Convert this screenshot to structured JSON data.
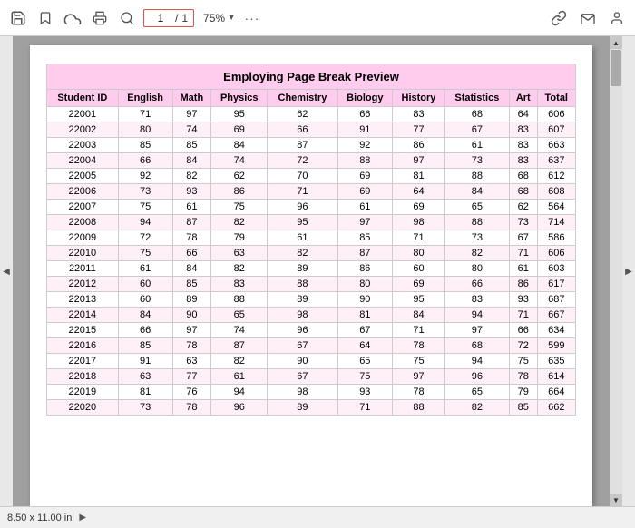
{
  "toolbar": {
    "page_current": "1",
    "page_sep": "/",
    "page_total": "1",
    "zoom_value": "75%",
    "more_label": "···"
  },
  "document": {
    "title": "Employing Page Break Preview",
    "columns": [
      "Student ID",
      "English",
      "Math",
      "Physics",
      "Chemistry",
      "Biology",
      "History",
      "Statistics",
      "Art",
      "Total"
    ],
    "rows": [
      [
        "22001",
        "71",
        "97",
        "95",
        "62",
        "66",
        "83",
        "68",
        "64",
        "606"
      ],
      [
        "22002",
        "80",
        "74",
        "69",
        "66",
        "91",
        "77",
        "67",
        "83",
        "607"
      ],
      [
        "22003",
        "85",
        "85",
        "84",
        "87",
        "92",
        "86",
        "61",
        "83",
        "663"
      ],
      [
        "22004",
        "66",
        "84",
        "74",
        "72",
        "88",
        "97",
        "73",
        "83",
        "637"
      ],
      [
        "22005",
        "92",
        "82",
        "62",
        "70",
        "69",
        "81",
        "88",
        "68",
        "612"
      ],
      [
        "22006",
        "73",
        "93",
        "86",
        "71",
        "69",
        "64",
        "84",
        "68",
        "608"
      ],
      [
        "22007",
        "75",
        "61",
        "75",
        "96",
        "61",
        "69",
        "65",
        "62",
        "564"
      ],
      [
        "22008",
        "94",
        "87",
        "82",
        "95",
        "97",
        "98",
        "88",
        "73",
        "714"
      ],
      [
        "22009",
        "72",
        "78",
        "79",
        "61",
        "85",
        "71",
        "73",
        "67",
        "586"
      ],
      [
        "22010",
        "75",
        "66",
        "63",
        "82",
        "87",
        "80",
        "82",
        "71",
        "606"
      ],
      [
        "22011",
        "61",
        "84",
        "82",
        "89",
        "86",
        "60",
        "80",
        "61",
        "603"
      ],
      [
        "22012",
        "60",
        "85",
        "83",
        "88",
        "80",
        "69",
        "66",
        "86",
        "617"
      ],
      [
        "22013",
        "60",
        "89",
        "88",
        "89",
        "90",
        "95",
        "83",
        "93",
        "687"
      ],
      [
        "22014",
        "84",
        "90",
        "65",
        "98",
        "81",
        "84",
        "94",
        "71",
        "667"
      ],
      [
        "22015",
        "66",
        "97",
        "74",
        "96",
        "67",
        "71",
        "97",
        "66",
        "634"
      ],
      [
        "22016",
        "85",
        "78",
        "87",
        "67",
        "64",
        "78",
        "68",
        "72",
        "599"
      ],
      [
        "22017",
        "91",
        "63",
        "82",
        "90",
        "65",
        "75",
        "94",
        "75",
        "635"
      ],
      [
        "22018",
        "63",
        "77",
        "61",
        "67",
        "75",
        "97",
        "96",
        "78",
        "614"
      ],
      [
        "22019",
        "81",
        "76",
        "94",
        "98",
        "93",
        "78",
        "65",
        "79",
        "664"
      ],
      [
        "22020",
        "73",
        "78",
        "96",
        "89",
        "71",
        "88",
        "82",
        "85",
        "662"
      ]
    ]
  },
  "bottom_bar": {
    "size": "8.50 x 11.00 in"
  }
}
